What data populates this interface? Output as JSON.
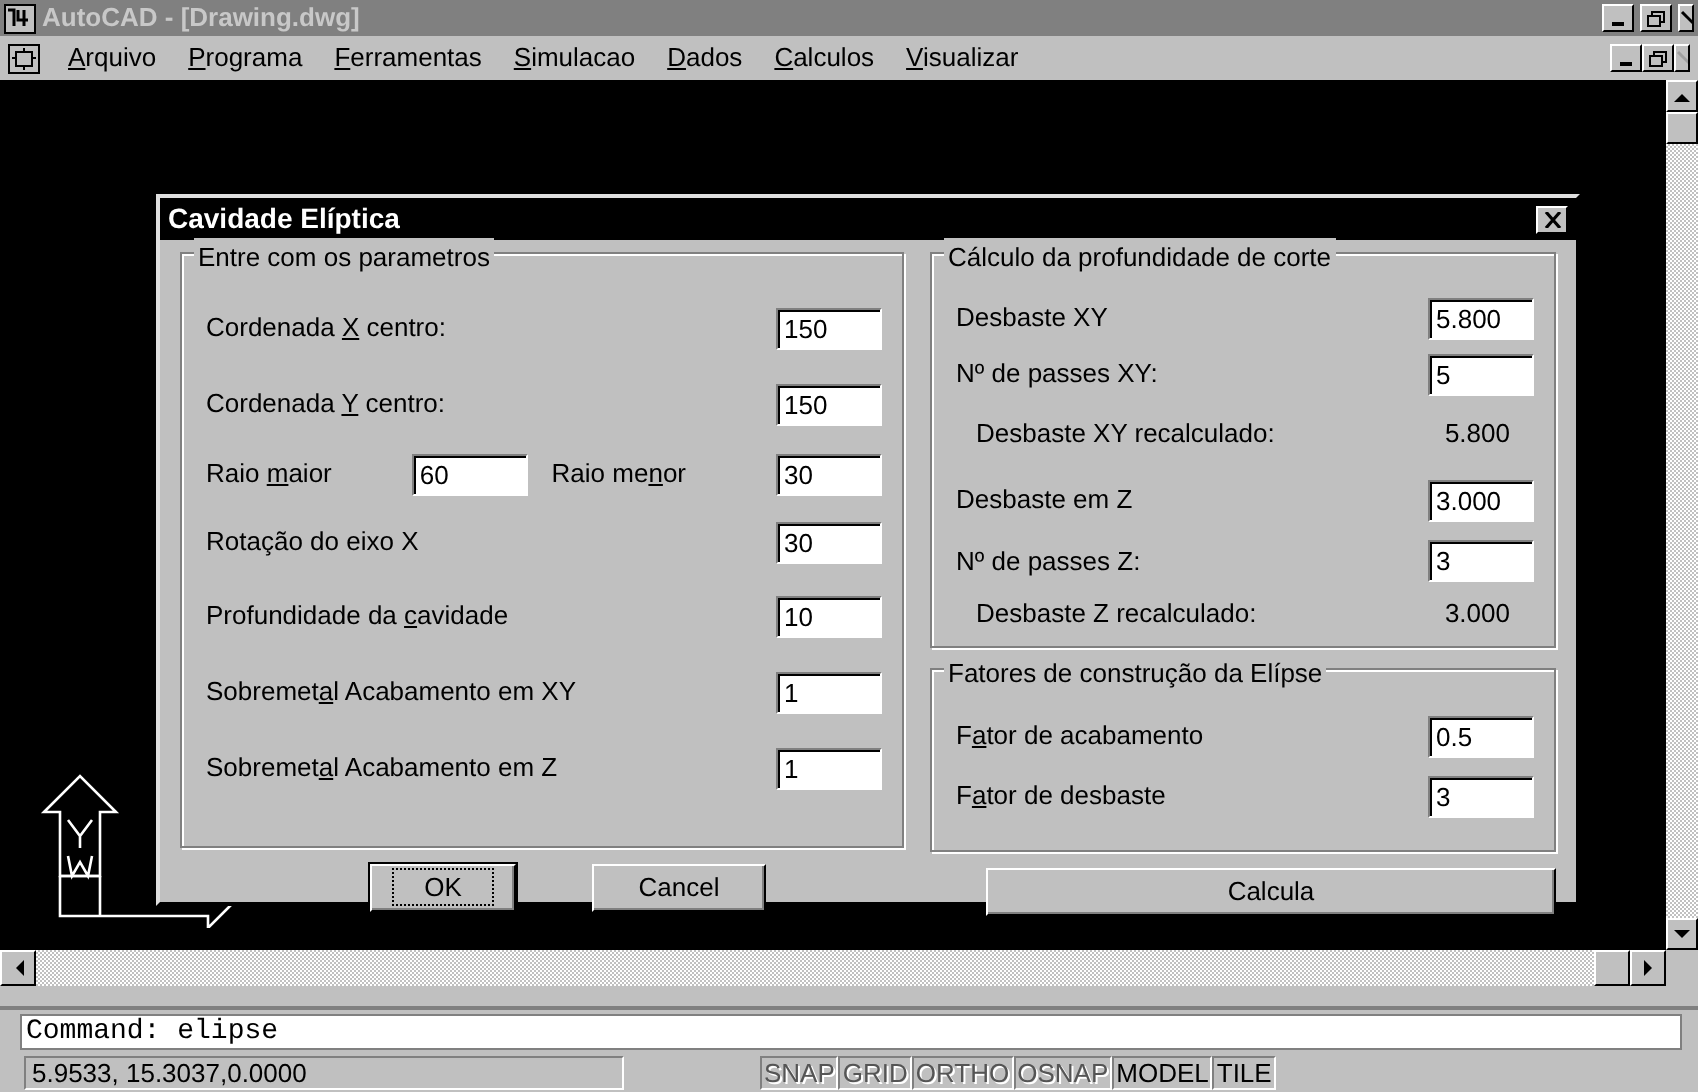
{
  "window": {
    "title": "AutoCAD - [Drawing.dwg]",
    "active": false
  },
  "menu": [
    {
      "key": "A",
      "rest": "rquivo"
    },
    {
      "key": "P",
      "rest": "rograma"
    },
    {
      "key": "F",
      "rest": "erramentas"
    },
    {
      "key": "S",
      "rest": "imulacao"
    },
    {
      "key": "D",
      "rest": "ados"
    },
    {
      "key": "C",
      "rest": "alculos"
    },
    {
      "key": "V",
      "rest": "isualizar"
    }
  ],
  "dialog": {
    "title": "Cavidade Elíptica",
    "parameters": {
      "title": "Entre com os parametros",
      "rows": [
        {
          "kind": "field",
          "label": {
            "text": "Cordenada ",
            "key": "X",
            "rest": " centro:"
          },
          "value": "150"
        },
        {
          "kind": "field",
          "label": {
            "text": "Cordenada ",
            "key": "Y",
            "rest": " centro:"
          },
          "value": "150"
        },
        {
          "kind": "pair",
          "items": [
            {
              "label": {
                "text": "Raio ",
                "key": "m",
                "rest": "aior"
              },
              "value": "60"
            },
            {
              "label": {
                "text": "Raio me",
                "key": "n",
                "rest": "or"
              },
              "value": "30"
            }
          ]
        },
        {
          "kind": "field",
          "label": {
            "text": "Rotação do eixo X"
          },
          "value": "30"
        },
        {
          "kind": "field",
          "label": {
            "text": "Profundidade da ",
            "key": "c",
            "rest": "avidade"
          },
          "value": "10"
        },
        {
          "kind": "field",
          "label": {
            "text": "Sobremet",
            "key": "a",
            "rest": "l  Acabamento em XY"
          },
          "value": "1"
        },
        {
          "kind": "field",
          "label": {
            "text": "Sobremet",
            "key": "a",
            "rest": "l  Acabamento em Z"
          },
          "value": "1"
        }
      ]
    },
    "depth": {
      "title": "Cálculo da profundidade de corte",
      "rows": [
        {
          "kind": "field",
          "label": {
            "text": "Desbaste XY"
          },
          "value": "5.800"
        },
        {
          "kind": "field",
          "label": {
            "text": "Nº de passes XY:"
          },
          "value": "5"
        },
        {
          "kind": "reading",
          "label": {
            "text": "Desbaste XY recalculado:"
          },
          "value": "5.800"
        },
        {
          "kind": "field",
          "label": {
            "text": "Desbaste em Z"
          },
          "value": "3.000"
        },
        {
          "kind": "field",
          "label": {
            "text": "Nº de passes Z:"
          },
          "value": "3"
        },
        {
          "kind": "reading",
          "label": {
            "text": "Desbaste Z recalculado:"
          },
          "value": "3.000"
        }
      ]
    },
    "factors": {
      "title": "Fatores de construção da Elípse",
      "rows": [
        {
          "kind": "field",
          "label": {
            "text": "F",
            "key": "a",
            "rest": "tor de acabamento"
          },
          "value": "0.5"
        },
        {
          "kind": "field",
          "label": {
            "text": "F",
            "key": "a",
            "rest": "tor de desbaste"
          },
          "value": "3"
        }
      ]
    },
    "buttons": [
      {
        "label": "OK",
        "default": true
      },
      {
        "label": "Cancel",
        "default": false
      }
    ],
    "calc_button": "Calcula"
  },
  "command_line": "Command: elipse",
  "status_bar": {
    "coordinates": "5.9533, 15.3037,0.0000",
    "toggles": [
      {
        "label": "SNAP",
        "on": false
      },
      {
        "label": "GRID",
        "on": false
      },
      {
        "label": "ORTHO",
        "on": false
      },
      {
        "label": "OSNAP",
        "on": false
      },
      {
        "label": "MODEL",
        "on": true
      },
      {
        "label": "TILE",
        "on": true
      }
    ]
  }
}
